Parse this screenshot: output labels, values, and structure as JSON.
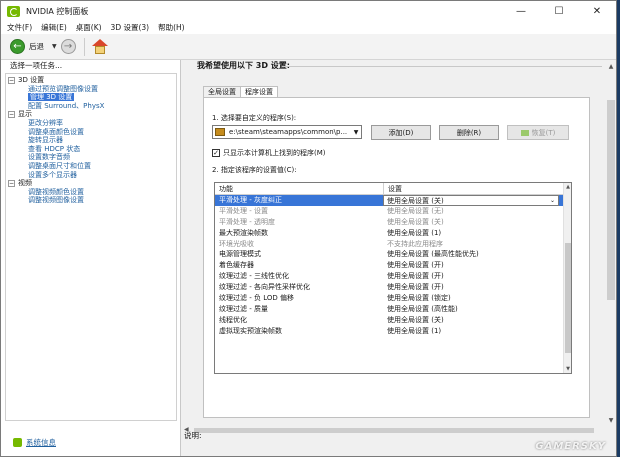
{
  "window": {
    "title": "NVIDIA 控制面板",
    "minimize": "—",
    "maximize": "☐",
    "close": "✕"
  },
  "menu": [
    "文件(F)",
    "编辑(E)",
    "桌面(K)",
    "3D 设置(3)",
    "帮助(H)"
  ],
  "toolbar": {
    "back_label": "后退"
  },
  "left": {
    "heading": "选择一项任务...",
    "tree": [
      {
        "type": "cat",
        "label": "3D 设置"
      },
      {
        "type": "sub",
        "label": "通过预览调整图像设置"
      },
      {
        "type": "sub",
        "label": "管理 3D 设置",
        "selected": true
      },
      {
        "type": "sub",
        "label": "配置 Surround、PhysX"
      },
      {
        "type": "cat",
        "label": "显示"
      },
      {
        "type": "sub",
        "label": "更改分辨率"
      },
      {
        "type": "sub",
        "label": "调整桌面颜色设置"
      },
      {
        "type": "sub",
        "label": "旋转显示器"
      },
      {
        "type": "sub",
        "label": "查看 HDCP 状态"
      },
      {
        "type": "sub",
        "label": "设置数字音频"
      },
      {
        "type": "sub",
        "label": "调整桌面尺寸和位置"
      },
      {
        "type": "sub",
        "label": "设置多个显示器"
      },
      {
        "type": "cat",
        "label": "视频"
      },
      {
        "type": "sub",
        "label": "调整视频颜色设置"
      },
      {
        "type": "sub",
        "label": "调整视频图像设置"
      }
    ],
    "system_info": "系统信息"
  },
  "main": {
    "heading": "我希望使用以下 3D 设置:",
    "tabs": [
      "全局设置",
      "程序设置"
    ],
    "step1_label": "1. 选择要自定义的程序(S):",
    "program_value": "e:\\steam\\steamapps\\common\\p...",
    "add_button": "添加(D)",
    "remove_button": "删除(R)",
    "restore_button": "恢复(T)",
    "checkbox_label": "只显示本计算机上找到的程序(M)",
    "step2_label": "2. 指定该程序的设置值(C):",
    "columns": [
      "功能",
      "设置"
    ],
    "rows": [
      {
        "feature": "平滑处理 - 灰度纠正",
        "setting": "使用全局设置 (关)",
        "state": "selected"
      },
      {
        "feature": "平滑处理 - 设置",
        "setting": "使用全局设置 (无)",
        "state": "gray"
      },
      {
        "feature": "平滑处理 - 透明度",
        "setting": "使用全局设置 (关)",
        "state": "gray"
      },
      {
        "feature": "最大预渲染帧数",
        "setting": "使用全局设置 (1)",
        "state": "normal"
      },
      {
        "feature": "环境光吸收",
        "setting": "不支持此应用程序",
        "state": "gray"
      },
      {
        "feature": "电源管理模式",
        "setting": "使用全局设置 (最高性能优先)",
        "state": "normal"
      },
      {
        "feature": "着色缓存器",
        "setting": "使用全局设置 (开)",
        "state": "normal"
      },
      {
        "feature": "纹理过滤 - 三线性优化",
        "setting": "使用全局设置 (开)",
        "state": "normal"
      },
      {
        "feature": "纹理过滤 - 各向异性采样优化",
        "setting": "使用全局设置 (开)",
        "state": "normal"
      },
      {
        "feature": "纹理过滤 - 负 LOD 偏移",
        "setting": "使用全局设置 (锁定)",
        "state": "normal"
      },
      {
        "feature": "纹理过滤 - 质量",
        "setting": "使用全局设置 (高性能)",
        "state": "normal"
      },
      {
        "feature": "线程优化",
        "setting": "使用全局设置 (关)",
        "state": "normal"
      },
      {
        "feature": "虚拟现实预渲染帧数",
        "setting": "使用全局设置 (1)",
        "state": "normal"
      }
    ],
    "description_label": "说明:"
  },
  "watermark": "GAMERSKY"
}
